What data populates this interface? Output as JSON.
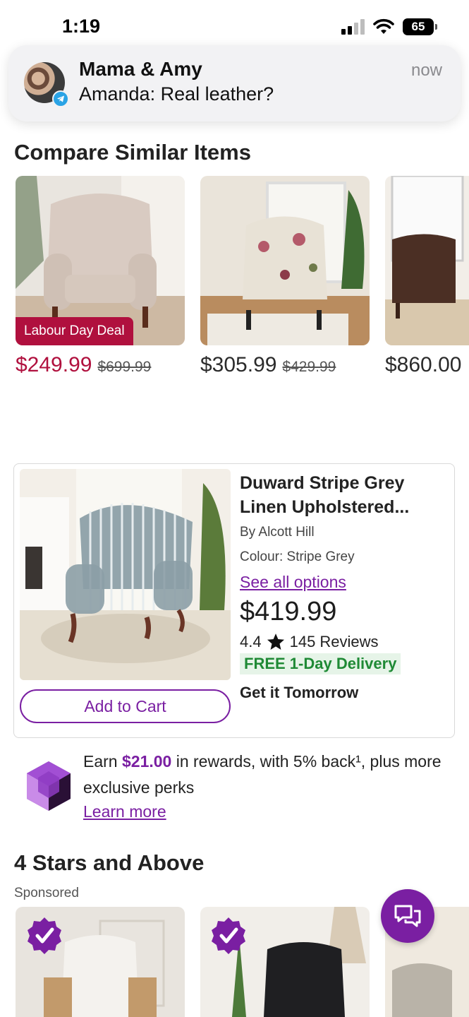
{
  "status_bar": {
    "time": "1:19",
    "battery": "65"
  },
  "notification": {
    "title": "Mama & Amy",
    "message": "Amanda: Real leather?",
    "time": "now"
  },
  "compare": {
    "heading": "Compare Similar Items",
    "items": [
      {
        "badge": "Labour Day Deal",
        "price": "$249.99",
        "was_price": "$699.99"
      },
      {
        "price": "$305.99",
        "was_price": "$429.99"
      },
      {
        "price": "$860.00"
      }
    ]
  },
  "product": {
    "title": "Duward Stripe Grey Linen Upholstered...",
    "brand": "By Alcott Hill",
    "colour": "Colour: Stripe Grey",
    "options_link": "See all options",
    "price": "$419.99",
    "rating": "4.4",
    "reviews": "145 Reviews",
    "delivery": "FREE 1-Day Delivery",
    "arrival": "Get it Tomorrow",
    "add_to_cart": "Add to Cart"
  },
  "rewards": {
    "prefix": "Earn ",
    "amount": "$21.00",
    "suffix": " in rewards, with 5% back¹, plus more exclusive perks",
    "learn_more": "Learn more"
  },
  "stars_section": {
    "heading": "4 Stars and Above",
    "sponsored": "Sponsored"
  },
  "icons": {
    "star": "star-icon",
    "chat": "chat-icon",
    "check": "check-badge-icon"
  },
  "colors": {
    "brand_purple": "#7a1fa2",
    "deal_red": "#b0103e",
    "delivery_green": "#1f8a35"
  }
}
